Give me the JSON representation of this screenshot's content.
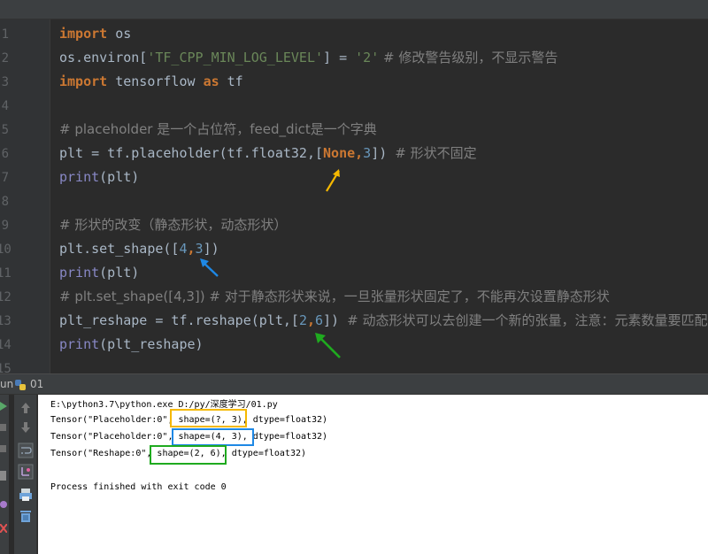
{
  "line_numbers": [
    "1",
    "2",
    "3",
    "4",
    "5",
    "6",
    "7",
    "8",
    "9",
    "10",
    "11",
    "12",
    "13",
    "14",
    "15"
  ],
  "code": {
    "l1": {
      "kw": "import",
      "rest": " os"
    },
    "l2": {
      "pre": "os.environ[",
      "str1": "'TF_CPP_MIN_LOG_LEVEL'",
      "mid": "] = ",
      "str2": "'2'",
      "cmt": " # 修改警告级别，不显示警告"
    },
    "l3": {
      "kw": "import",
      "mid": " tensorflow ",
      "kw2": "as",
      "rest": " tf"
    },
    "l5": {
      "cmt": "# placeholder 是一个占位符，feed_dict是一个字典"
    },
    "l6": {
      "pre": "plt = tf.placeholder(tf.float32,[",
      "none": "None",
      "comma": ",",
      "num": "3",
      "post": "]) ",
      "cmt": "# 形状不固定"
    },
    "l7": {
      "bi": "print",
      "rest": "(plt)"
    },
    "l9": {
      "cmt": "# 形状的改变（静态形状，动态形状）"
    },
    "l10": {
      "pre": "plt.set_shape([",
      "n1": "4",
      "comma": ",",
      "n2": "3",
      "post": "])"
    },
    "l11": {
      "bi": "print",
      "rest": "(plt)"
    },
    "l12": {
      "cmt": "# plt.set_shape([4,3]) # 对于静态形状来说，一旦张量形状固定了，不能再次设置静态形状"
    },
    "l13": {
      "pre": "plt_reshape = tf.reshape(plt,[",
      "n1": "2",
      "comma": ",",
      "n2": "6",
      "post": "]) ",
      "cmt": "# 动态形状可以去创建一个新的张量，注意：元素数量要匹配"
    },
    "l14": {
      "bi": "print",
      "rest": "(plt_reshape)"
    }
  },
  "run_panel": {
    "label": "un",
    "config_name": "01"
  },
  "console": {
    "cmd_line": "E:\\python3.7\\python.exe D:/py/深度学习/01.py",
    "out1": {
      "pre": "Tensor(\"Placeholder:0\", ",
      "shape": "shape=(?, 3)",
      "post": ", dtype=float32)"
    },
    "out2": {
      "pre": "Tensor(\"Placeholder:0\", ",
      "shape": "shape=(4, 3)",
      "post": ", dtype=float32)"
    },
    "out3": {
      "pre": "Tensor(\"Reshape:0\", ",
      "shape": "shape=(2, 6)",
      "post": ", dtype=float32)"
    },
    "finish": "Process finished with exit code 0"
  },
  "colors": {
    "annotation_yellow": "#f5b800",
    "annotation_blue": "#1e88e5",
    "annotation_green": "#1faa1f"
  },
  "icons": [
    "python-icon",
    "rerun-icon",
    "stop-icon",
    "up-arrow-icon",
    "down-arrow-icon",
    "soft-wrap-icon",
    "scroll-to-end-icon",
    "print-icon",
    "trash-icon"
  ]
}
